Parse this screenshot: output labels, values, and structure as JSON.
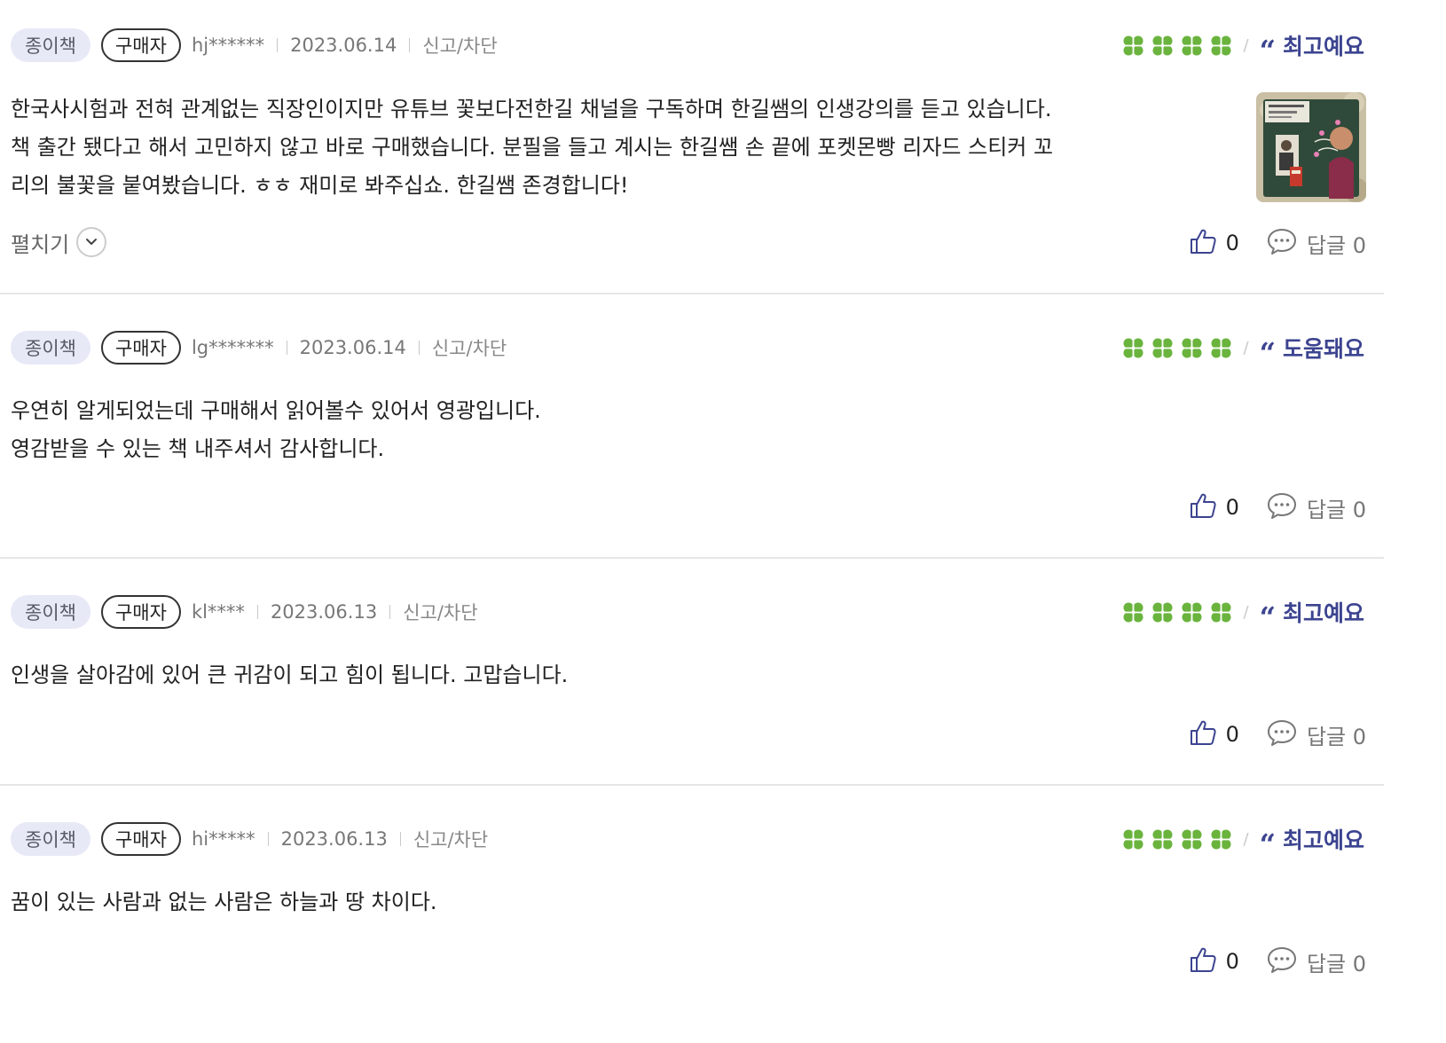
{
  "labels": {
    "format": "종이책",
    "buyer": "구매자",
    "report": "신고/차단",
    "expand": "펼치기"
  },
  "icons": {
    "rating": "clover-icon",
    "quote": "quote-icon",
    "like": "thumbs-up-icon",
    "reply": "speech-bubble-icon",
    "expand": "chevron-down-icon"
  },
  "colors": {
    "clover": "#6ab43e",
    "emotion": "#3c4490",
    "format_tag_bg": "#e8e9f7"
  },
  "reviews": [
    {
      "user": "hj******",
      "date": "2023.06.14",
      "rating": 4,
      "emotion": "최고예요",
      "lines": [
        "한국사시험과 전혀 관계없는 직장인이지만 유튜브 꽃보다전한길 채널을 구독하며 한길쌤의 인생강의를 듣고 있습니다.",
        "책 출간 됐다고 해서 고민하지 않고 바로 구매했습니다. 분필을 들고 계시는 한길쌤 손 끝에 포켓몬빵 리자드 스티커 꼬",
        "리의 불꽃을 붙여봤습니다. ㅎㅎ 재미로 봐주십쇼. 한길쌤 존경합니다!"
      ],
      "likes": "0",
      "reply": "답글 0"
    },
    {
      "user": "lg*******",
      "date": "2023.06.14",
      "rating": 4,
      "emotion": "도움돼요",
      "lines": [
        "우연히 알게되었는데 구매해서 읽어볼수 있어서 영광입니다.",
        "영감받을 수 있는 책 내주셔서 감사합니다."
      ],
      "likes": "0",
      "reply": "답글 0"
    },
    {
      "user": "kl****",
      "date": "2023.06.13",
      "rating": 4,
      "emotion": "최고예요",
      "lines": [
        "인생을 살아감에 있어 큰 귀감이 되고 힘이 됩니다. 고맙습니다."
      ],
      "likes": "0",
      "reply": "답글 0"
    },
    {
      "user": "hi*****",
      "date": "2023.06.13",
      "rating": 4,
      "emotion": "최고예요",
      "lines": [
        "꿈이 있는 사람과 없는 사람은 하늘과 땅 차이다."
      ],
      "likes": "0",
      "reply": "답글 0"
    }
  ]
}
